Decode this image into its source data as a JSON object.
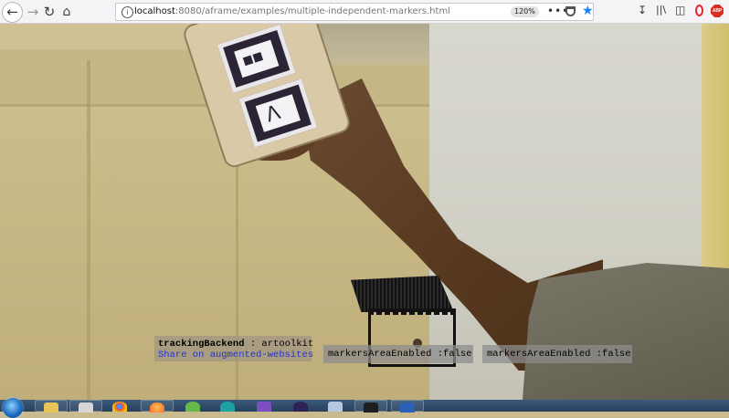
{
  "browser": {
    "url_host": "localhost",
    "url_path": ":8080/aframe/examples/multiple-independent-markers.html",
    "zoom": "120%",
    "page_actions": "•••",
    "star": "★"
  },
  "overlay": {
    "tracking_key": "trackingBackend",
    "tracking_value": " : artoolkit",
    "share_link": "Share on augmented-websites",
    "markers_area_1": "markersAreaEnabled :false",
    "markers_area_2": "markersAreaEnabled :false"
  },
  "icons": {
    "back": "back-arrow-icon",
    "forward": "forward-arrow-icon",
    "reload": "reload-icon",
    "home": "home-icon",
    "download": "download-icon",
    "library": "library-icon",
    "sidebar": "sidebar-icon",
    "opera": "opera-icon",
    "adblock": "adblock-icon"
  },
  "taskbar": {
    "apps": [
      "file-explorer",
      "paint",
      "chrome",
      "firefox",
      "app-green",
      "arduino",
      "visual-studio",
      "eclipse",
      "virtualbox",
      "terminal",
      "word"
    ]
  },
  "colors": {
    "star": "#0a84ff",
    "share_link": "#2233cc",
    "adblock": "#d93025"
  }
}
